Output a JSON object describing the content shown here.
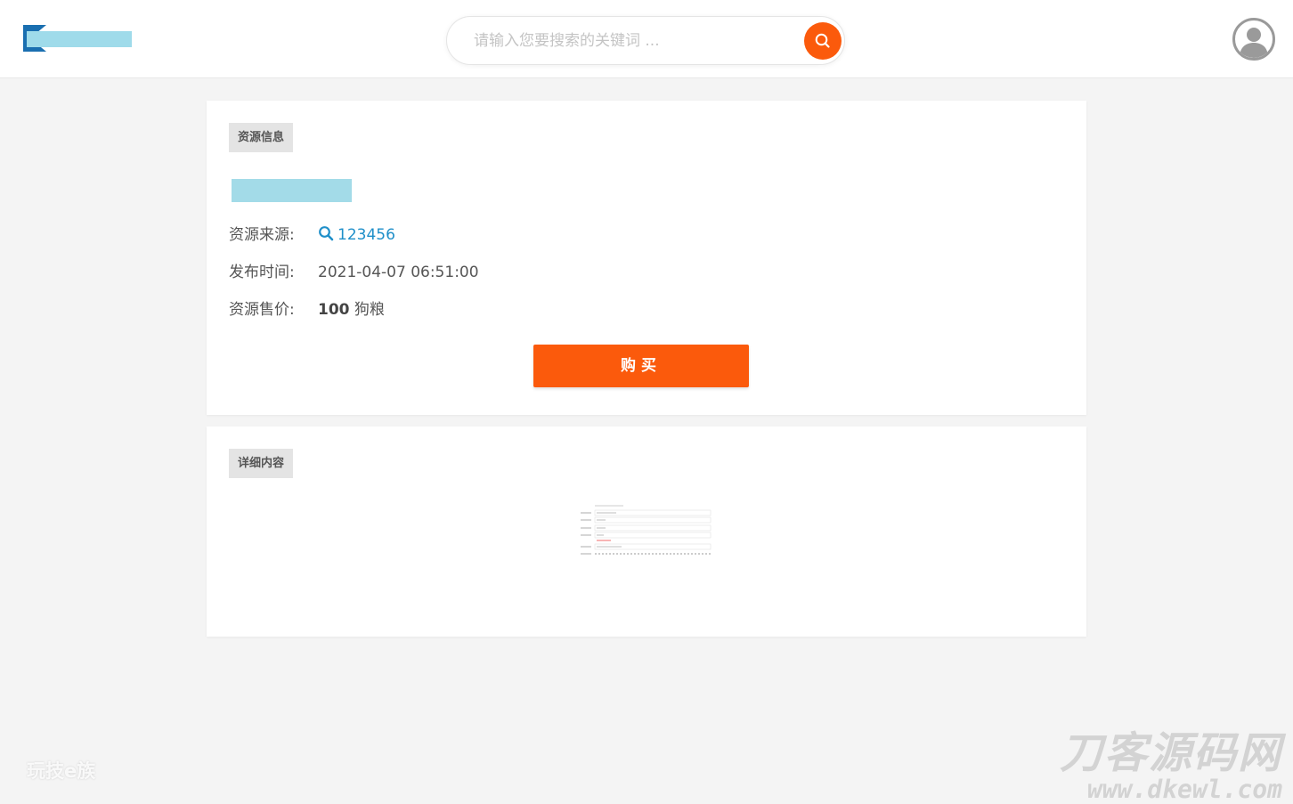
{
  "header": {
    "search": {
      "placeholder": "请输入您要搜索的关键词 ...",
      "value": ""
    }
  },
  "info_card": {
    "tag": "资源信息",
    "source_label": "资源来源:",
    "source_value": "123456",
    "time_label": "发布时间:",
    "time_value": "2021-04-07 06:51:00",
    "price_label": "资源售价:",
    "price_value": "100",
    "price_unit": "狗粮",
    "buy_label": "购买"
  },
  "detail_card": {
    "tag": "详细内容"
  },
  "watermarks": {
    "left": "玩技e族",
    "right_title": "刀客源码网",
    "right_url": "www.dkewl.com"
  },
  "colors": {
    "accent": "#fb5a0c",
    "link": "#1f8fc9",
    "background": "#f4f4f4"
  },
  "icons": [
    "search-icon",
    "user-avatar-icon",
    "magnifier-icon"
  ]
}
